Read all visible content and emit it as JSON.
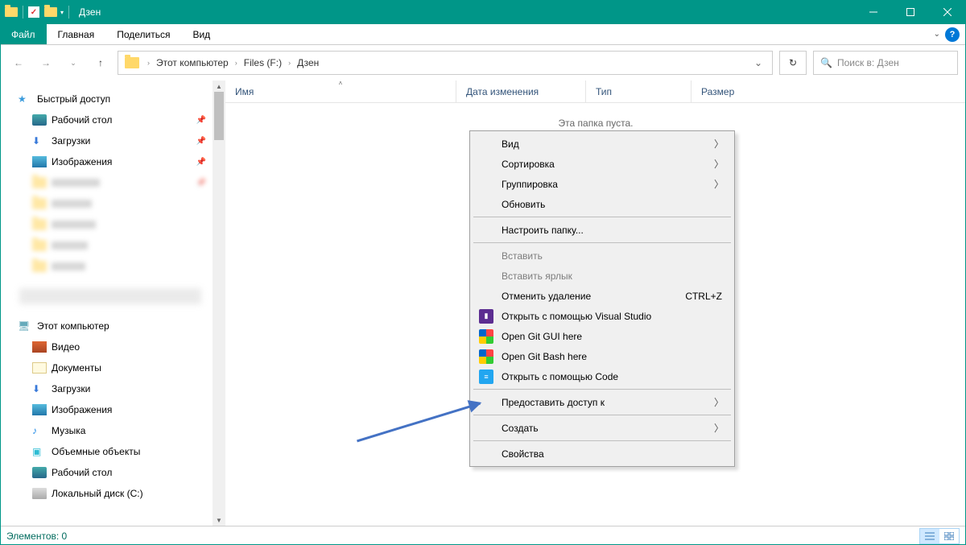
{
  "window": {
    "title": "Дзен",
    "ribbon": {
      "file": "Файл",
      "tabs": [
        "Главная",
        "Поделиться",
        "Вид"
      ]
    }
  },
  "nav": {
    "breadcrumbs": [
      "Этот компьютер",
      "Files (F:)",
      "Дзен"
    ],
    "search_placeholder": "Поиск в: Дзен"
  },
  "sidebar": {
    "quick_access": "Быстрый доступ",
    "quick_items": [
      {
        "label": "Рабочий стол",
        "pinned": true,
        "icoClass": "ico-desktop"
      },
      {
        "label": "Загрузки",
        "pinned": true,
        "icoClass": "ico-downloads"
      },
      {
        "label": "Изображения",
        "pinned": true,
        "icoClass": "ico-pictures"
      }
    ],
    "this_pc": "Этот компьютер",
    "pc_items": [
      {
        "label": "Видео",
        "icoClass": "ico-video"
      },
      {
        "label": "Документы",
        "icoClass": "ico-docs"
      },
      {
        "label": "Загрузки",
        "icoClass": "ico-downloads"
      },
      {
        "label": "Изображения",
        "icoClass": "ico-pictures"
      },
      {
        "label": "Музыка",
        "icoClass": "ico-music"
      },
      {
        "label": "Объемные объекты",
        "icoClass": "ico-3d"
      },
      {
        "label": "Рабочий стол",
        "icoClass": "ico-desktop"
      },
      {
        "label": "Локальный диск (C:)",
        "icoClass": "ico-disk"
      }
    ]
  },
  "columns": {
    "name": "Имя",
    "date": "Дата изменения",
    "type": "Тип",
    "size": "Размер"
  },
  "empty_msg": "Эта папка пуста.",
  "context_menu": {
    "view": "Вид",
    "sort": "Сортировка",
    "group": "Группировка",
    "refresh": "Обновить",
    "customize": "Настроить папку...",
    "paste": "Вставить",
    "paste_shortcut": "Вставить ярлык",
    "undo_delete": "Отменить удаление",
    "undo_delete_key": "CTRL+Z",
    "open_vs": "Открыть с помощью Visual Studio",
    "open_git_gui": "Open Git GUI here",
    "open_git_bash": "Open Git Bash here",
    "open_code": "Открыть с помощью Code",
    "share_access": "Предоставить доступ к",
    "create": "Создать",
    "properties": "Свойства"
  },
  "statusbar": {
    "text": "Элементов: 0"
  }
}
